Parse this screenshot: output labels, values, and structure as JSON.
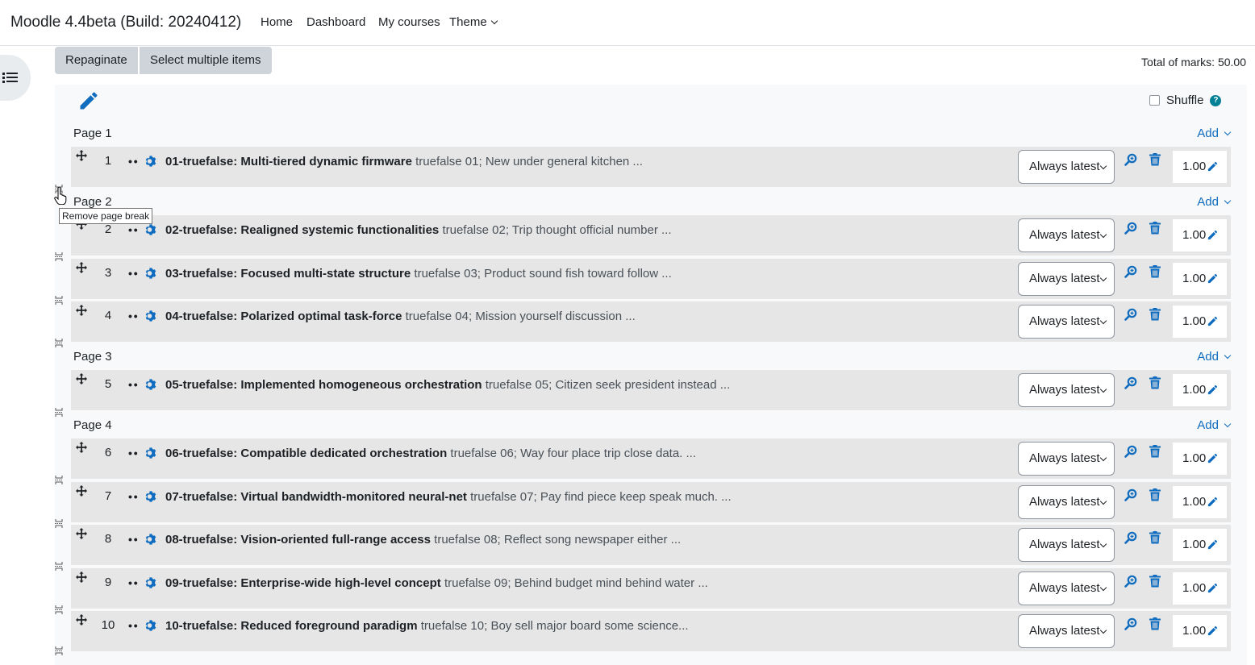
{
  "site": {
    "brand": "Moodle 4.4beta (Build: 20240412)",
    "nav": [
      "Home",
      "Dashboard",
      "My courses",
      "Theme"
    ]
  },
  "toolbar": {
    "repaginate_label": "Repaginate",
    "select_multiple_label": "Select multiple items",
    "total_marks": "Total of marks: 50.00"
  },
  "shuffle_label": "Shuffle",
  "add_label": "Add",
  "tooltip": "Remove page break",
  "pages": [
    "Page 1",
    "Page 2",
    "Page 3",
    "Page 4"
  ],
  "version_option": "Always latest",
  "questions": [
    {
      "num": "1",
      "name": "01-truefalse: Multi-tiered dynamic firmware",
      "desc": "truefalse 01; New under general kitchen ...",
      "mark": "1.00"
    },
    {
      "num": "2",
      "name": "02-truefalse: Realigned systemic functionalities",
      "desc": "truefalse 02; Trip thought official number ...",
      "mark": "1.00"
    },
    {
      "num": "3",
      "name": "03-truefalse: Focused multi-state structure",
      "desc": "truefalse 03; Product sound fish toward follow ...",
      "mark": "1.00"
    },
    {
      "num": "4",
      "name": "04-truefalse: Polarized optimal task-force",
      "desc": "truefalse 04; Mission yourself discussion ...",
      "mark": "1.00"
    },
    {
      "num": "5",
      "name": "05-truefalse: Implemented homogeneous orchestration",
      "desc": "truefalse 05; Citizen seek president instead ...",
      "mark": "1.00"
    },
    {
      "num": "6",
      "name": "06-truefalse: Compatible dedicated orchestration",
      "desc": "truefalse 06; Way four place trip close data. ...",
      "mark": "1.00"
    },
    {
      "num": "7",
      "name": "07-truefalse: Virtual bandwidth-monitored neural-net",
      "desc": "truefalse 07; Pay find piece keep speak much. ...",
      "mark": "1.00"
    },
    {
      "num": "8",
      "name": "08-truefalse: Vision-oriented full-range access",
      "desc": "truefalse 08; Reflect song newspaper either ...",
      "mark": "1.00"
    },
    {
      "num": "9",
      "name": "09-truefalse: Enterprise-wide high-level concept",
      "desc": "truefalse 09; Behind budget mind behind water ...",
      "mark": "1.00"
    },
    {
      "num": "10",
      "name": "10-truefalse: Reduced foreground paradigm",
      "desc": "truefalse 10; Boy sell major board some science...",
      "mark": "1.00"
    }
  ],
  "colors": {
    "accent": "#0f6cbf",
    "row_bg": "#e6e6e6",
    "container_bg": "#f8f9fa"
  }
}
